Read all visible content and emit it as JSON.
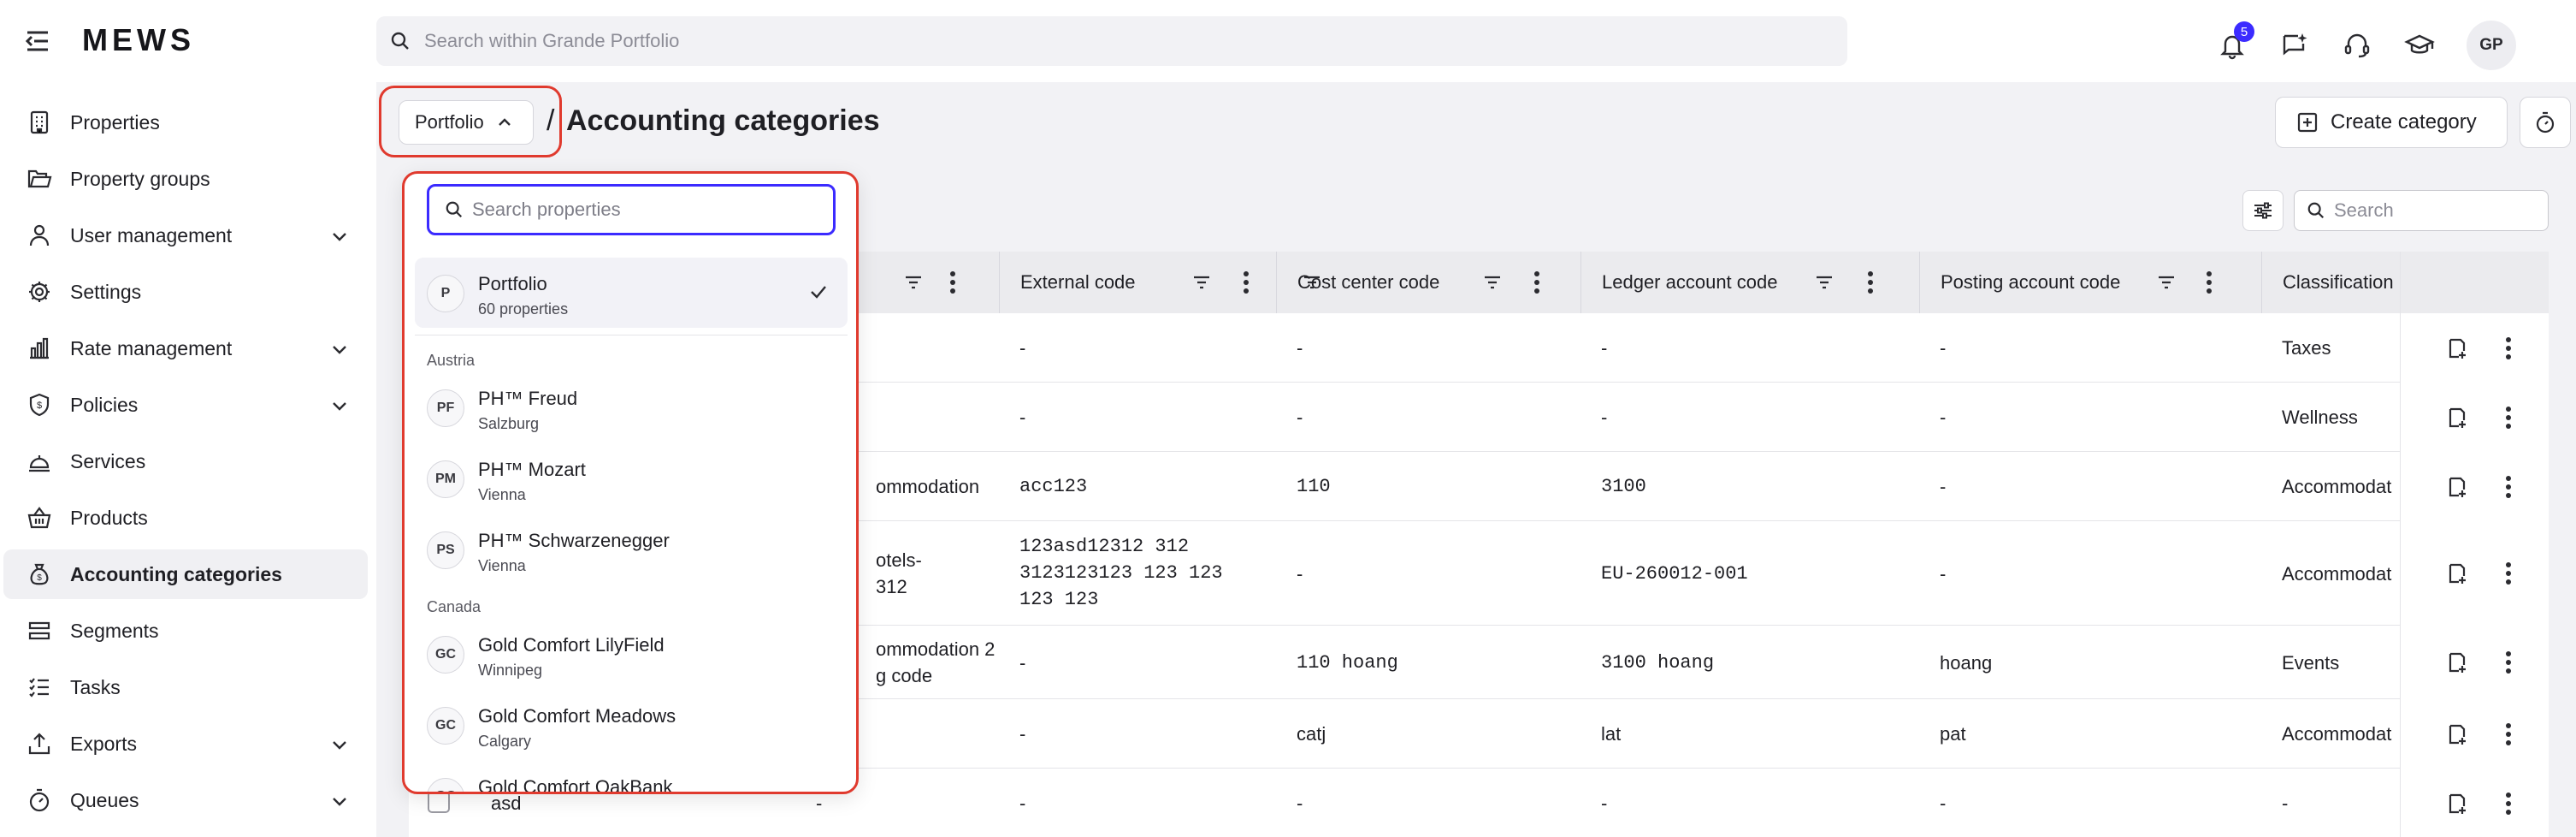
{
  "app": {
    "logo": "MEWS"
  },
  "topbar": {
    "search_placeholder": "Search within Grande Portfolio",
    "notifications_count": "5",
    "avatar_initials": "GP"
  },
  "sidebar": {
    "items": [
      {
        "label": "Properties",
        "icon": "building-icon",
        "expandable": false
      },
      {
        "label": "Property groups",
        "icon": "folder-icon",
        "expandable": false
      },
      {
        "label": "User management",
        "icon": "user-icon",
        "expandable": true
      },
      {
        "label": "Settings",
        "icon": "gear-icon",
        "expandable": false
      },
      {
        "label": "Rate management",
        "icon": "bar-chart-icon",
        "expandable": true
      },
      {
        "label": "Policies",
        "icon": "shield-icon",
        "expandable": true
      },
      {
        "label": "Services",
        "icon": "service-bell-icon",
        "expandable": false
      },
      {
        "label": "Products",
        "icon": "basket-icon",
        "expandable": false
      },
      {
        "label": "Accounting categories",
        "icon": "money-bag-icon",
        "expandable": false,
        "active": true
      },
      {
        "label": "Segments",
        "icon": "segments-icon",
        "expandable": false
      },
      {
        "label": "Tasks",
        "icon": "task-list-icon",
        "expandable": false
      },
      {
        "label": "Exports",
        "icon": "export-icon",
        "expandable": true
      },
      {
        "label": "Queues",
        "icon": "stopwatch-icon",
        "expandable": true
      }
    ]
  },
  "header": {
    "portfolio_label": "Portfolio",
    "separator": "/",
    "title": "Accounting categories",
    "create_label": "Create category"
  },
  "table_search": {
    "placeholder": "Search"
  },
  "table": {
    "columns": [
      "External code",
      "Cost center code",
      "Ledger account code",
      "Posting account code",
      "Classification"
    ],
    "rows": [
      {
        "name": "",
        "external": "-",
        "cost": "-",
        "ledger": "-",
        "posting": "-",
        "class": "Taxes"
      },
      {
        "name": "",
        "external": "-",
        "cost": "-",
        "ledger": "-",
        "posting": "-",
        "class": "Wellness"
      },
      {
        "name": "ommodation",
        "external": "acc123",
        "cost": "110",
        "ledger": "3100",
        "posting": "-",
        "class": "Accommodat"
      },
      {
        "name": "otels-\n312",
        "external": "123asd12312 312\n3123123123 123 123\n123 123",
        "cost": "-",
        "ledger": "EU-260012-001",
        "posting": "-",
        "class": "Accommodat"
      },
      {
        "name": "ommodation 2\ng code",
        "external": "-",
        "cost": "110 hoang",
        "ledger": "3100 hoang",
        "posting": "hoang",
        "class": "Events"
      },
      {
        "name": "",
        "external": "-",
        "cost": "catj",
        "ledger": "lat",
        "posting": "pat",
        "class": "Accommodat"
      },
      {
        "name": "asd",
        "name_col2": "-",
        "external": "-",
        "cost": "-",
        "ledger": "-",
        "posting": "-",
        "class": "-"
      }
    ]
  },
  "dropdown": {
    "search_placeholder": "Search properties",
    "portfolio": {
      "initials": "P",
      "name": "Portfolio",
      "sub": "60 properties"
    },
    "groups": [
      {
        "label": "Austria",
        "items": [
          {
            "initials": "PF",
            "name": "PH™ Freud",
            "sub": "Salzburg"
          },
          {
            "initials": "PM",
            "name": "PH™ Mozart",
            "sub": "Vienna"
          },
          {
            "initials": "PS",
            "name": "PH™ Schwarzenegger",
            "sub": "Vienna"
          }
        ]
      },
      {
        "label": "Canada",
        "items": [
          {
            "initials": "GC",
            "name": "Gold Comfort LilyField",
            "sub": "Winnipeg"
          },
          {
            "initials": "GC",
            "name": "Gold Comfort Meadows",
            "sub": "Calgary"
          },
          {
            "initials": "GC",
            "name": "Gold Comfort OakBank",
            "sub": ""
          }
        ]
      }
    ]
  },
  "colors": {
    "accent": "#3b2bff",
    "highlight": "#e03a2e",
    "active_bg": "#f0f0f3"
  }
}
